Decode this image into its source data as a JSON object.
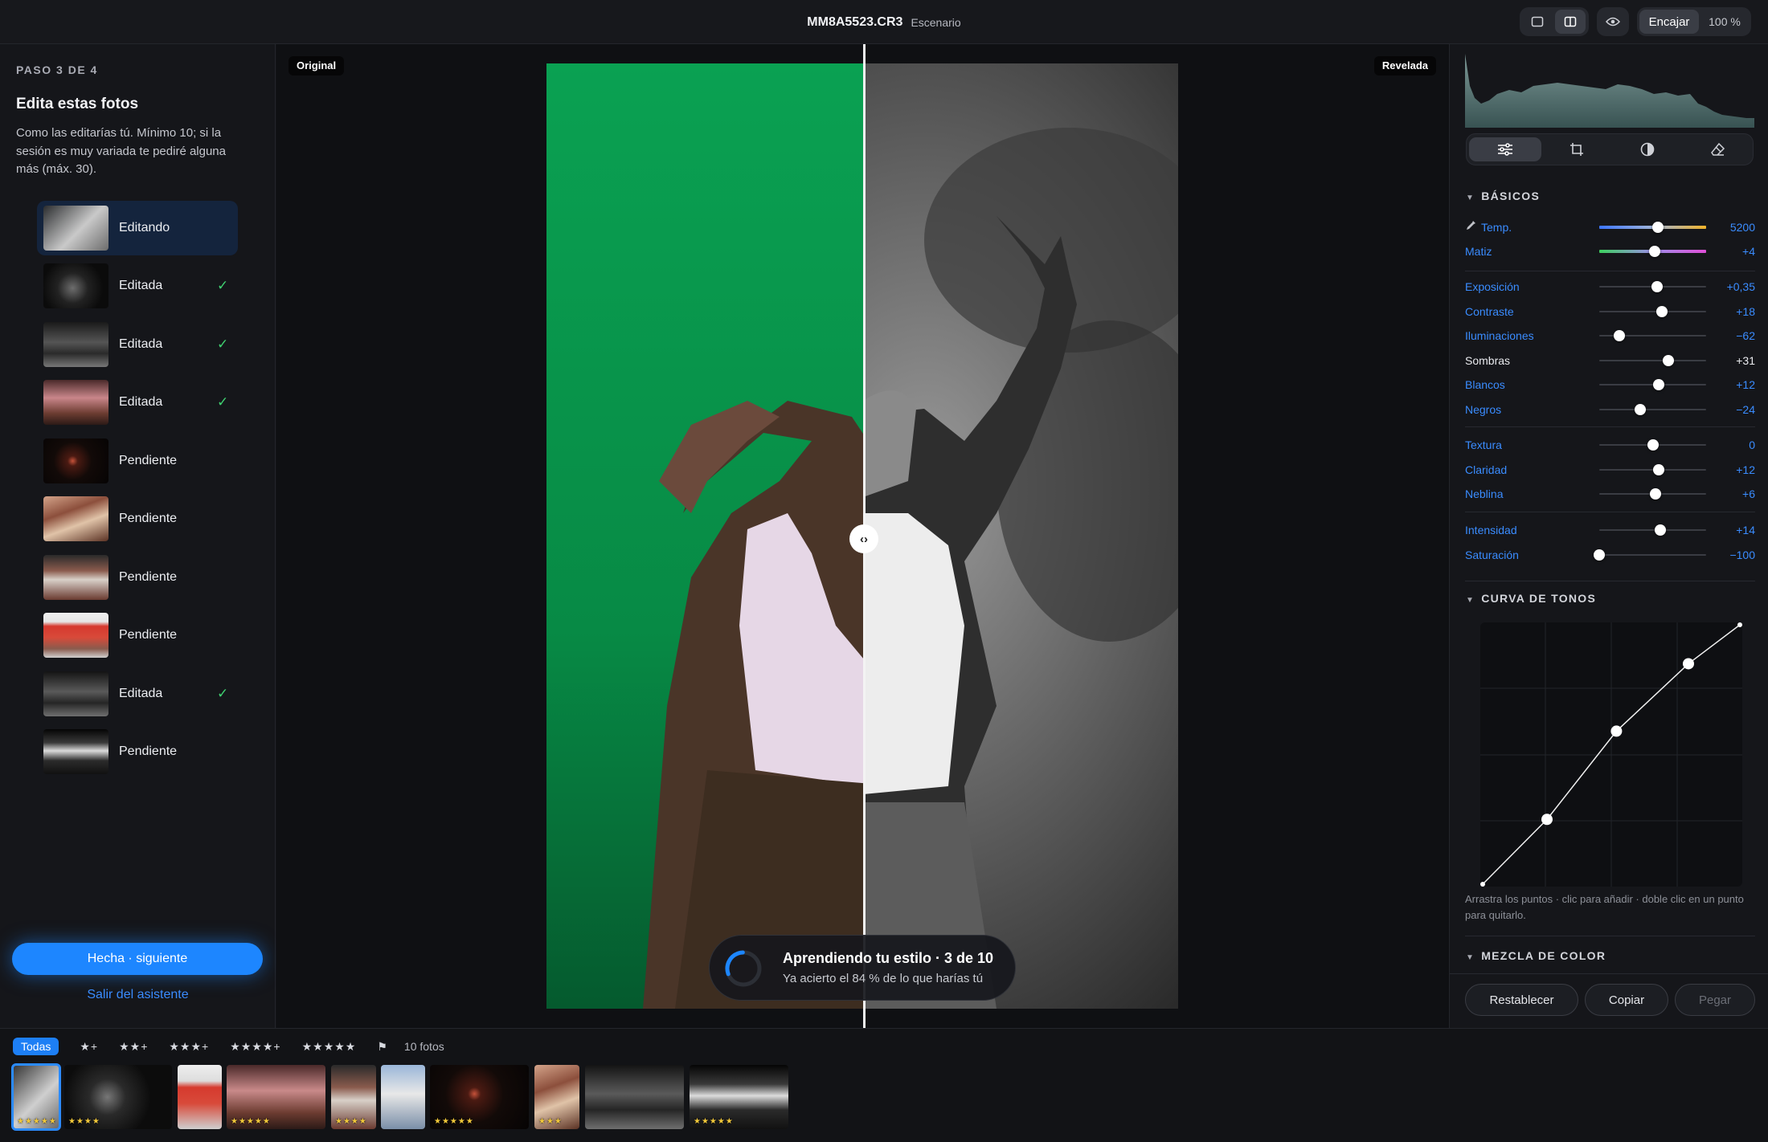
{
  "app": {
    "filename": "MM8A5523.CR3",
    "subtitle": "Escenario",
    "zoom_fit": "Encajar",
    "zoom_value": "100 %"
  },
  "wizard": {
    "step": "PASO 3 DE 4",
    "title": "Edita estas fotos",
    "description": "Como las editarías tú. Mínimo 10; si la sesión es muy variada te pediré alguna más (máx. 30).",
    "items": [
      {
        "status": "Editando",
        "check": ""
      },
      {
        "status": "Editada",
        "check": "✓"
      },
      {
        "status": "Editada",
        "check": "✓"
      },
      {
        "status": "Editada",
        "check": "✓"
      },
      {
        "status": "Pendiente",
        "check": ""
      },
      {
        "status": "Pendiente",
        "check": ""
      },
      {
        "status": "Pendiente",
        "check": ""
      },
      {
        "status": "Pendiente",
        "check": ""
      },
      {
        "status": "Editada",
        "check": "✓"
      },
      {
        "status": "Pendiente",
        "check": ""
      }
    ],
    "done_button": "Hecha · siguiente",
    "exit_link": "Salir del asistente"
  },
  "canvas": {
    "label_original": "Original",
    "label_revealed": "Revelada",
    "split_fraction": 0.5,
    "toast_title": "Aprendiendo tu estilo · 3 de 10",
    "toast_subtitle": "Ya acierto el 84 % de lo que harías tú",
    "progress_fraction": 0.3
  },
  "panel": {
    "basics_title": "BÁSICOS",
    "sliders": [
      {
        "label": "Temp.",
        "value": "5200",
        "pos": 0.55,
        "color": "blue",
        "track": "temp"
      },
      {
        "label": "Matiz",
        "value": "+4",
        "pos": 0.52,
        "color": "blue",
        "track": "tint"
      },
      {
        "label": "Exposición",
        "value": "+0,35",
        "pos": 0.54,
        "color": "blue",
        "track": "plain"
      },
      {
        "label": "Contraste",
        "value": "+18",
        "pos": 0.59,
        "color": "blue",
        "track": "plain"
      },
      {
        "label": "Iluminaciones",
        "value": "−62",
        "pos": 0.19,
        "color": "blue",
        "track": "plain"
      },
      {
        "label": "Sombras",
        "value": "+31",
        "pos": 0.65,
        "color": "white",
        "track": "plain"
      },
      {
        "label": "Blancos",
        "value": "+12",
        "pos": 0.56,
        "color": "blue",
        "track": "plain"
      },
      {
        "label": "Negros",
        "value": "−24",
        "pos": 0.38,
        "color": "blue",
        "track": "plain"
      },
      {
        "label": "Textura",
        "value": "0",
        "pos": 0.5,
        "color": "blue",
        "track": "plain"
      },
      {
        "label": "Claridad",
        "value": "+12",
        "pos": 0.56,
        "color": "blue",
        "track": "plain"
      },
      {
        "label": "Neblina",
        "value": "+6",
        "pos": 0.53,
        "color": "blue",
        "track": "plain"
      },
      {
        "label": "Intensidad",
        "value": "+14",
        "pos": 0.57,
        "color": "blue",
        "track": "plain"
      },
      {
        "label": "Saturación",
        "value": "−100",
        "pos": 0.0,
        "color": "blue",
        "track": "plain"
      }
    ],
    "curve_title": "CURVA DE TONOS",
    "curve_hint": "Arrastra los puntos · clic para añadir · doble clic en un punto para quitarlo.",
    "curve_points": [
      [
        0,
        0
      ],
      [
        0.25,
        0.25
      ],
      [
        0.52,
        0.59
      ],
      [
        0.8,
        0.85
      ],
      [
        1,
        1
      ]
    ],
    "mix_title": "MEZCLA DE COLOR",
    "reset_button": "Restablecer",
    "copy_button": "Copiar",
    "paste_button": "Pegar"
  },
  "filmstrip": {
    "filters": [
      "Todas",
      "★+",
      "★★+",
      "★★★+",
      "★★★★+",
      "★★★★★"
    ],
    "flag": "⚑",
    "count": "10 fotos",
    "thumbs": [
      {
        "stars": "★★★★★",
        "selected": true
      },
      {
        "stars": "★★★★",
        "selected": false
      },
      {
        "stars": "",
        "selected": false
      },
      {
        "stars": "★★★★★",
        "selected": false
      },
      {
        "stars": "★★★★",
        "selected": false
      },
      {
        "stars": "",
        "selected": false
      },
      {
        "stars": "★★★★★",
        "selected": false
      },
      {
        "stars": "★★★",
        "selected": false
      },
      {
        "stars": "",
        "selected": false
      },
      {
        "stars": "★★★★★",
        "selected": false
      }
    ]
  },
  "colors": {
    "accent": "#1d86ff",
    "check": "#3fd070",
    "green_screen": "#0a9a4c"
  }
}
